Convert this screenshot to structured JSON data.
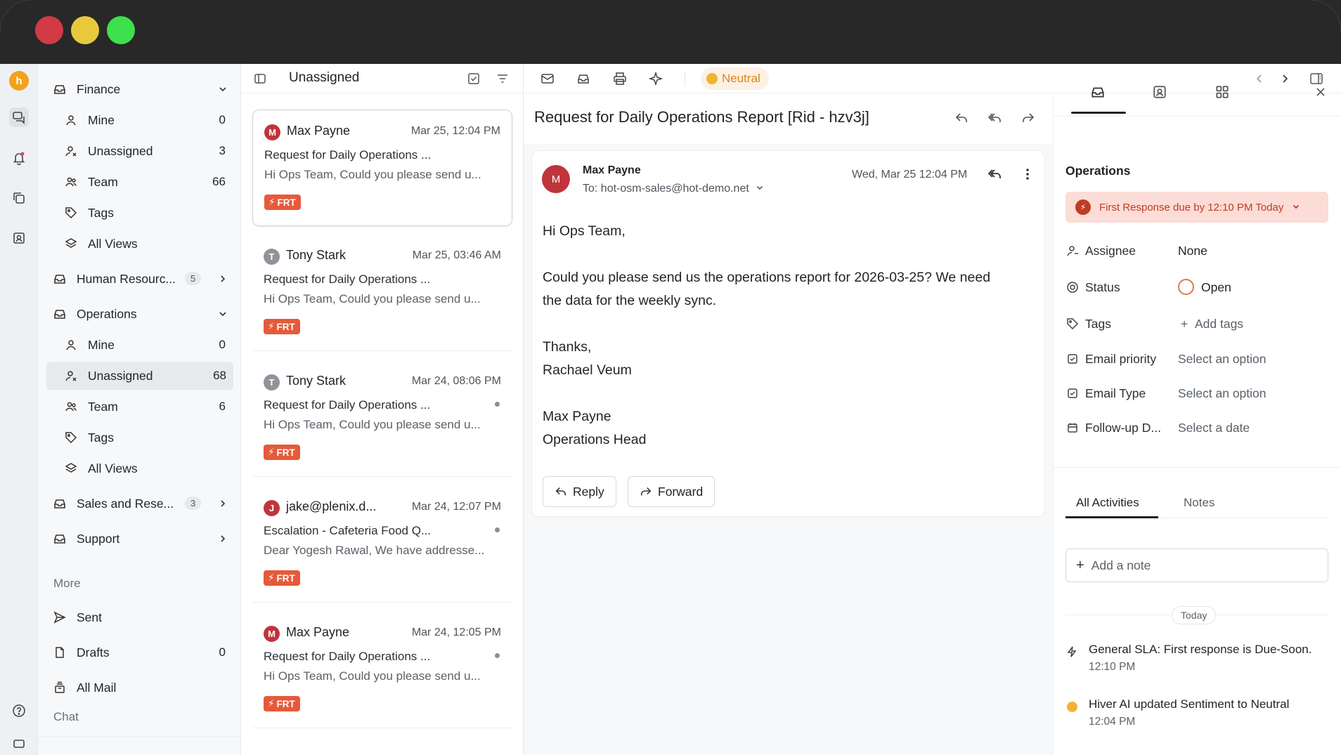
{
  "sidebar": {
    "groups": [
      {
        "label": "Finance",
        "expanded": true
      },
      {
        "label": "Human Resourc...",
        "badge": "5"
      },
      {
        "label": "Operations",
        "expanded": true
      },
      {
        "label": "Sales and Rese...",
        "badge": "3"
      },
      {
        "label": "Support"
      }
    ],
    "finance_items": [
      {
        "label": "Mine",
        "count": "0"
      },
      {
        "label": "Unassigned",
        "count": "3"
      },
      {
        "label": "Team",
        "count": "66"
      },
      {
        "label": "Tags",
        "count": ""
      },
      {
        "label": "All Views",
        "count": ""
      }
    ],
    "operations_items": [
      {
        "label": "Mine",
        "count": "0"
      },
      {
        "label": "Unassigned",
        "count": "68"
      },
      {
        "label": "Team",
        "count": "6"
      },
      {
        "label": "Tags",
        "count": ""
      },
      {
        "label": "All Views",
        "count": ""
      }
    ],
    "more_title": "More",
    "more_items": [
      {
        "label": "Sent",
        "count": ""
      },
      {
        "label": "Drafts",
        "count": "0"
      },
      {
        "label": "All Mail",
        "count": ""
      }
    ],
    "chat_title": "Chat"
  },
  "list": {
    "title": "Unassigned",
    "cards": [
      {
        "initial": "M",
        "color": "#c0343c",
        "sender": "Max Payne",
        "date": "Mar 25, 12:04 PM",
        "subject": "Request for Daily Operations ...",
        "preview": "Hi Ops Team, Could you please send u...",
        "tag": "FRT",
        "unread": false
      },
      {
        "initial": "T",
        "color": "#8e949a",
        "sender": "Tony Stark",
        "date": "Mar 25, 03:46 AM",
        "subject": "Request for Daily Operations ...",
        "preview": "Hi Ops Team, Could you please send u...",
        "tag": "FRT",
        "unread": false
      },
      {
        "initial": "T",
        "color": "#8e949a",
        "sender": "Tony Stark",
        "date": "Mar 24, 08:06 PM",
        "subject": "Request for Daily Operations ...",
        "preview": "Hi Ops Team, Could you please send u...",
        "tag": "FRT",
        "unread": true
      },
      {
        "initial": "J",
        "color": "#c0343c",
        "sender": "jake@plenix.d...",
        "date": "Mar 24, 12:07 PM",
        "subject": "Escalation - Cafeteria Food Q...",
        "preview": "Dear Yogesh Rawal, We have addresse...",
        "tag": "FRT",
        "unread": true
      },
      {
        "initial": "M",
        "color": "#c0343c",
        "sender": "Max Payne",
        "date": "Mar 24, 12:05 PM",
        "subject": "Request for Daily Operations ...",
        "preview": "Hi Ops Team, Could you please send u...",
        "tag": "FRT",
        "unread": true
      }
    ]
  },
  "toolbar": {
    "sentiment": "Neutral"
  },
  "email": {
    "subject": "Request for Daily Operations Report [Rid - hzv3j]",
    "initial": "M",
    "from": "Max Payne",
    "to": "To: hot-osm-sales@hot-demo.net",
    "date": "Wed, Mar 25 12:04 PM",
    "body": [
      "Hi Ops Team,",
      "",
      "Could you please send us the operations report for 2026-03-25? We need",
      "the data for the weekly sync.",
      "",
      "Thanks,",
      "Rachael Veum",
      "",
      "Max Payne",
      "Operations Head"
    ],
    "reply_label": "Reply",
    "forward_label": "Forward"
  },
  "details": {
    "title": "Operations",
    "sla_text": "First Response due by 12:10 PM Today",
    "fields": [
      {
        "label": "Assignee",
        "value": "None"
      },
      {
        "label": "Status",
        "value": "Open"
      },
      {
        "label": "Tags",
        "value": "Add tags"
      },
      {
        "label": "Email priority",
        "value": "Select an option"
      },
      {
        "label": "Email Type",
        "value": "Select an option"
      },
      {
        "label": "Follow-up D...",
        "value": "Select a date"
      }
    ],
    "activity_tabs": [
      "All Activities",
      "Notes"
    ],
    "add_note": "Add a note",
    "today": "Today",
    "activities": [
      {
        "text": "General SLA: First response is Due-Soon.",
        "time": "12:10 PM"
      },
      {
        "text": "Hiver AI updated Sentiment to Neutral",
        "time": "12:04 PM"
      }
    ]
  }
}
